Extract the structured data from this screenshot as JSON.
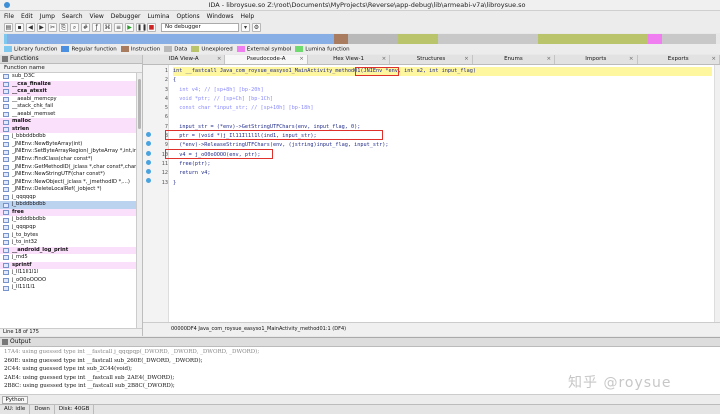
{
  "window": {
    "title": "IDA - libroysue.so Z:\\root\\Documents\\MyProjects\\Reverse\\app-debug\\lib\\armeabi-v7a\\libroysue.so"
  },
  "menu": [
    "File",
    "Edit",
    "Jump",
    "Search",
    "View",
    "Debugger",
    "Lumina",
    "Options",
    "Windows",
    "Help"
  ],
  "toolbar": {
    "debugger_select": "No debugger"
  },
  "legend": [
    {
      "label": "Library function",
      "color": "#7ec8f0"
    },
    {
      "label": "Regular function",
      "color": "#4a8fe0"
    },
    {
      "label": "Instruction",
      "color": "#a97c5f"
    },
    {
      "label": "Data",
      "color": "#b9b9b9"
    },
    {
      "label": "Unexplored",
      "color": "#b9c46b"
    },
    {
      "label": "External symbol",
      "color": "#f07ef0"
    },
    {
      "label": "Lumina function",
      "color": "#6fdb6f"
    }
  ],
  "functions": {
    "title": "Functions",
    "column": "Function name",
    "status": "Line 18 of 175",
    "items": [
      {
        "name": "sub_D3C",
        "kind": "normal"
      },
      {
        "name": "__cxa_finalize",
        "kind": "lib"
      },
      {
        "name": "__cxa_atexit",
        "kind": "lib"
      },
      {
        "name": "__aeabi_memcpy",
        "kind": "normal"
      },
      {
        "name": "__stack_chk_fail",
        "kind": "normal"
      },
      {
        "name": "__aeabi_memset",
        "kind": "normal"
      },
      {
        "name": "malloc",
        "kind": "lib"
      },
      {
        "name": "strlen",
        "kind": "lib"
      },
      {
        "name": "j_bbbddbdbb",
        "kind": "normal"
      },
      {
        "name": "_JNIEnv::NewByteArray(int)",
        "kind": "normal"
      },
      {
        "name": "_JNIEnv::SetByteArrayRegion(_jbyteArray *,int,int...",
        "kind": "normal"
      },
      {
        "name": "_JNIEnv::FindClass(char const*)",
        "kind": "normal"
      },
      {
        "name": "_JNIEnv::GetMethodID(_jclass *,char const*,char ...",
        "kind": "normal"
      },
      {
        "name": "_JNIEnv::NewStringUTF(char const*)",
        "kind": "normal"
      },
      {
        "name": "_JNIEnv::NewObject(_jclass *,_jmethodID *,...)",
        "kind": "normal"
      },
      {
        "name": "_JNIEnv::DeleteLocalRef(_jobject *)",
        "kind": "normal"
      },
      {
        "name": "j_qqqqqp",
        "kind": "normal"
      },
      {
        "name": "j_bbddbbdbb",
        "kind": "sel"
      },
      {
        "name": "free",
        "kind": "lib"
      },
      {
        "name": "j_bdddbbdbb",
        "kind": "normal"
      },
      {
        "name": "j_qqqpqp",
        "kind": "normal"
      },
      {
        "name": "j_to_bytes",
        "kind": "normal"
      },
      {
        "name": "j_to_int32",
        "kind": "normal"
      },
      {
        "name": "__android_log_print",
        "kind": "lib"
      },
      {
        "name": "j_md5",
        "kind": "normal"
      },
      {
        "name": "sprintf",
        "kind": "lib"
      },
      {
        "name": "j_Il11Il1l1l",
        "kind": "normal"
      },
      {
        "name": "j_oO0oOOOO",
        "kind": "normal"
      },
      {
        "name": "j_Il11l1l1",
        "kind": "normal"
      }
    ]
  },
  "tabs": [
    "IDA View-A",
    "Pseudocode-A",
    "Hex View-1",
    "Structures",
    "Enums",
    "Imports",
    "Exports"
  ],
  "code": {
    "lines": [
      {
        "n": "1",
        "text": "int __fastcall Java_com_roysue_easyso1_MainActivity_method01(JNIEnv *env, int a2, int input_flag)",
        "style": "hl"
      },
      {
        "n": "2",
        "text": "{",
        "style": ""
      },
      {
        "n": "3",
        "text": "  int v4; // [sp+8h] [bp-20h]",
        "style": "cmt"
      },
      {
        "n": "4",
        "text": "  void *ptr; // [sp+Ch] [bp-1Ch]",
        "style": "cmt"
      },
      {
        "n": "5",
        "text": "  const char *input_str; // [sp+10h] [bp-18h]",
        "style": "cmt"
      },
      {
        "n": "6",
        "text": "",
        "style": ""
      },
      {
        "n": "7",
        "text": "  input_str = (*env)->GetStringUTFChars(env, input_flag, 0);",
        "style": ""
      },
      {
        "n": "8",
        "text": "  ptr = (void *)j_Il11Il1l1l(ind1, input_str);",
        "style": ""
      },
      {
        "n": "9",
        "text": "  (*env)->ReleaseStringUTFChars(env, (jstring)input_flag, input_str);",
        "style": ""
      },
      {
        "n": "10",
        "text": "  v4 = j_oO0oOOOO(env, ptr);",
        "style": ""
      },
      {
        "n": "11",
        "text": "  free(ptr);",
        "style": ""
      },
      {
        "n": "12",
        "text": "  return v4;",
        "style": ""
      },
      {
        "n": "13",
        "text": "}",
        "style": ""
      }
    ],
    "status": "00000DF4 Java_com_roysue_easyso1_MainActivity_method01:1 (DF4)"
  },
  "output": {
    "title": "Output",
    "lines": [
      "17A4: using guessed type int __fastcall j_qqqpqp(_DWORD, _DWORD, _DWORD, _DWORD);",
      "260E: using guessed type int __fastcall sub_260E(_DWORD, _DWORD);",
      "2C44: using guessed type int sub_2C44(void);",
      "2AE4: using guessed type int __fastcall sub_2AE4(_DWORD);",
      "2B8C: using guessed type int __fastcall sub_2B8C(_DWORD);"
    ],
    "python": "Python"
  },
  "status": {
    "state": "AU: idle",
    "dir": "Down",
    "disk": "Disk: 40GB"
  },
  "watermark": "知乎 @roysue"
}
